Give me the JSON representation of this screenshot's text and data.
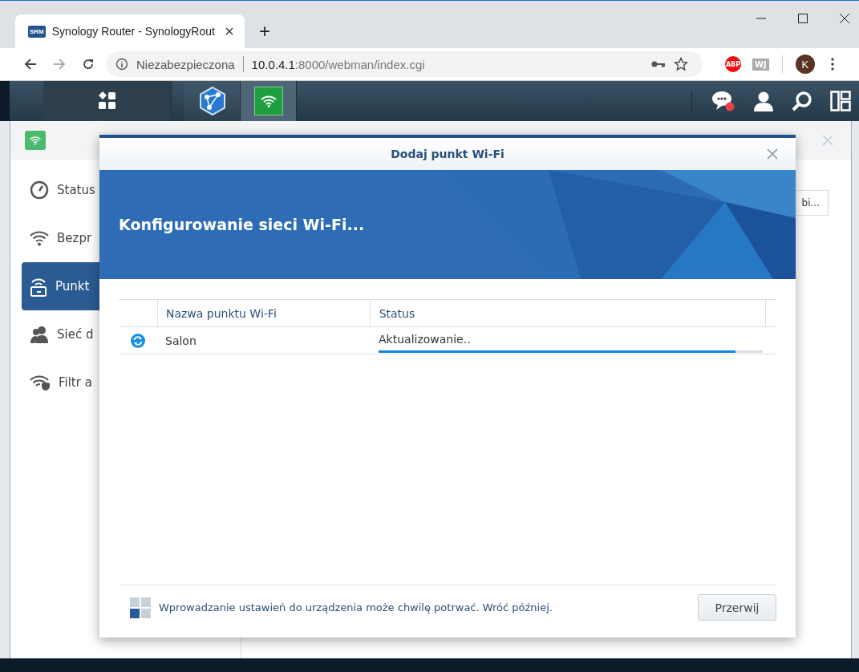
{
  "browser": {
    "tab": {
      "favicon_text": "SRM",
      "title": "Synology Router - SynologyRout",
      "selected": true
    },
    "new_tab": "+",
    "address": {
      "security": "Niezabezpieczona",
      "host": "10.0.4.1",
      "path": ":8000/webman/index.cgi"
    },
    "extensions": [
      "ABP",
      "WJ"
    ],
    "profile": "K"
  },
  "taskbar": {
    "apps": [
      {
        "kind": "menu",
        "selected": false
      },
      {
        "kind": "network",
        "selected": false
      },
      {
        "kind": "wifi",
        "selected": true
      }
    ]
  },
  "sidebar": {
    "items": [
      {
        "label": "Status",
        "kind": "gauge",
        "selected": false
      },
      {
        "label": "Bezpr",
        "kind": "wifi",
        "selected": false
      },
      {
        "label": "Punkt",
        "kind": "access-point",
        "selected": true
      },
      {
        "label": "Sieć d",
        "kind": "users",
        "selected": false
      },
      {
        "label": "Filtr a",
        "kind": "filter",
        "selected": false
      }
    ]
  },
  "background_cell": "bi...",
  "dialog": {
    "title": "Dodaj punkt Wi-Fi",
    "heading": "Konfigurowanie sieci Wi-Fi...",
    "table": {
      "columns": [
        "Nazwa punktu Wi-Fi",
        "Status"
      ],
      "rows": [
        {
          "name": "Salon",
          "status": "Aktualizowanie..",
          "level": 0.93
        }
      ]
    },
    "footer_note": "Wprowadzanie ustawień do urządzenia może chwilę potrwać. Wróć później.",
    "buttons": [
      "Przerwij"
    ]
  }
}
